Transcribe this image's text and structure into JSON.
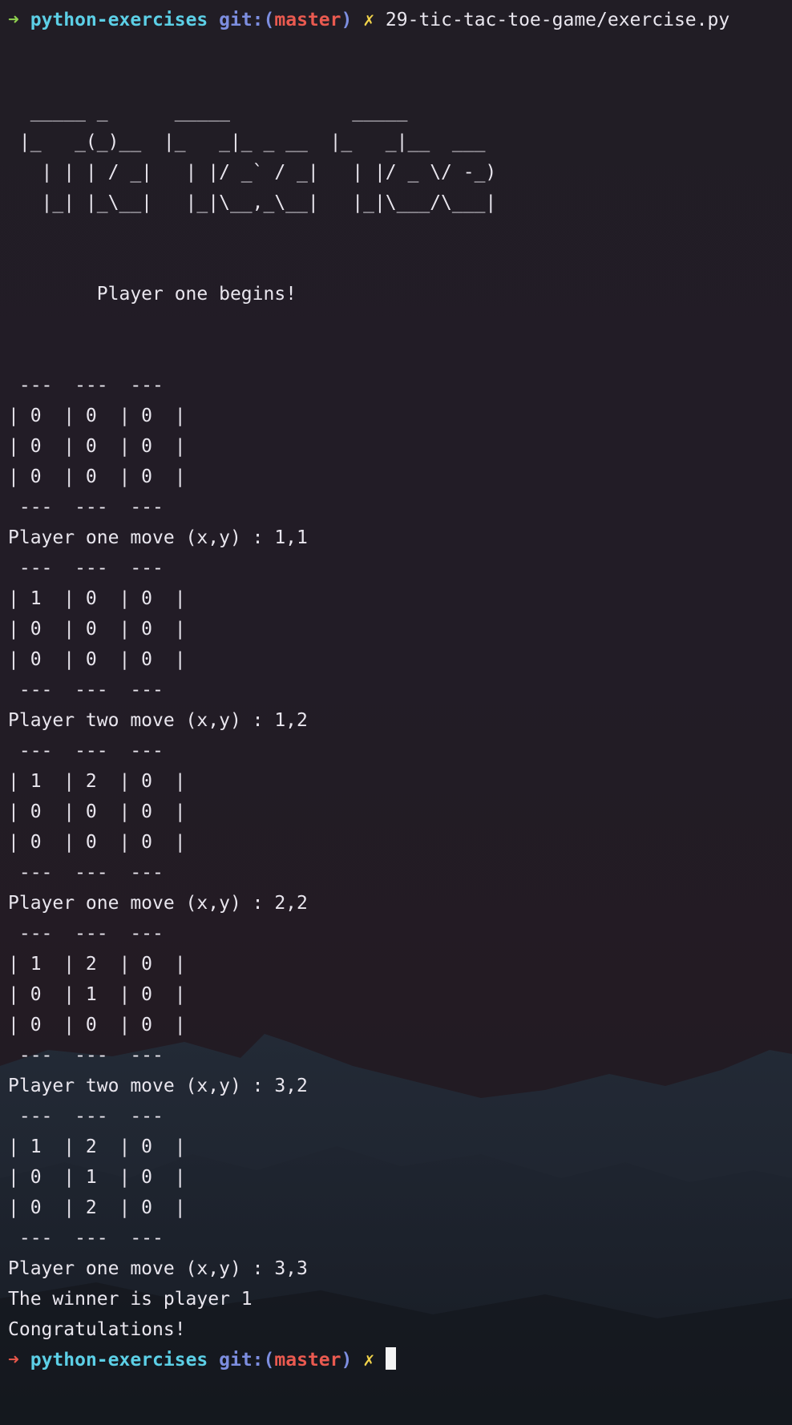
{
  "prompt_top": {
    "arrow": "➜",
    "directory": "python-exercises",
    "git_label": "git:",
    "paren_open": "(",
    "branch": "master",
    "paren_close": ")",
    "dirty_mark": "✗",
    "command": "29-tic-tac-toe-game/exercise.py"
  },
  "banner": [
    "  _____ _      _____           _____",
    " |_   _(_)__  |_   _|_ _ __  |_   _|__  ___",
    "   | | | / _|   | |/ _` / _|   | |/ _ \\/ -_)",
    "   |_| |_\\__|   |_|\\__,_\\__|   |_|\\___/\\___|"
  ],
  "intro": "        Player one begins!",
  "boards": [
    {
      "rows": [
        "| 0  | 0  | 0  |",
        "| 0  | 0  | 0  |",
        "| 0  | 0  | 0  |"
      ],
      "move": "Player one move (x,y) : 1,1"
    },
    {
      "rows": [
        "| 1  | 0  | 0  |",
        "| 0  | 0  | 0  |",
        "| 0  | 0  | 0  |"
      ],
      "move": "Player two move (x,y) : 1,2"
    },
    {
      "rows": [
        "| 1  | 2  | 0  |",
        "| 0  | 0  | 0  |",
        "| 0  | 0  | 0  |"
      ],
      "move": "Player one move (x,y) : 2,2"
    },
    {
      "rows": [
        "| 1  | 2  | 0  |",
        "| 0  | 1  | 0  |",
        "| 0  | 0  | 0  |"
      ],
      "move": "Player two move (x,y) : 3,2"
    },
    {
      "rows": [
        "| 1  | 2  | 0  |",
        "| 0  | 1  | 0  |",
        "| 0  | 2  | 0  |"
      ],
      "move": "Player one move (x,y) : 3,3"
    }
  ],
  "board_border": " ---  ---  ---",
  "result": "The winner is player 1",
  "congrats": "Congratulations!",
  "prompt_bottom": {
    "arrow": "➜",
    "directory": "python-exercises",
    "git_label": "git:",
    "paren_open": "(",
    "branch": "master",
    "paren_close": ")",
    "dirty_mark": "✗"
  },
  "colors": {
    "arrow_success": "#8fd14f",
    "arrow_error": "#e8574a",
    "directory": "#5ccfe6",
    "git_label": "#7d8ee0",
    "branch": "#ea5a50",
    "dirty_mark": "#f2d34a",
    "text": "#e9e6ee",
    "background": "#211d25"
  }
}
